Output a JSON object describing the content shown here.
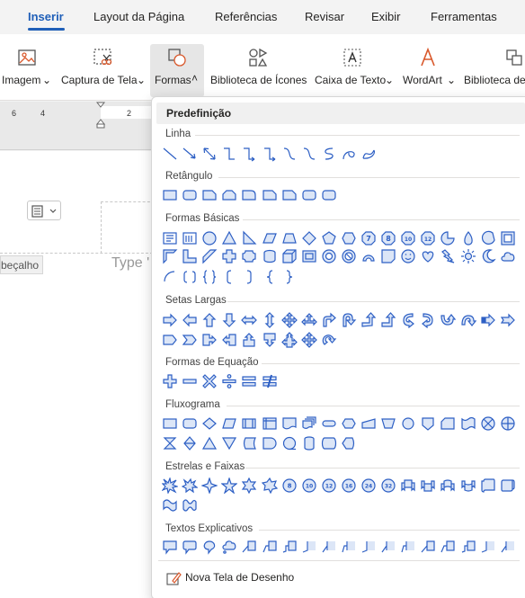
{
  "tabs": [
    {
      "label": "Inserir",
      "active": true
    },
    {
      "label": "Layout da Página"
    },
    {
      "label": "Referências"
    },
    {
      "label": "Revisar"
    },
    {
      "label": "Exibir"
    },
    {
      "label": "Ferramentas"
    }
  ],
  "ribbon": {
    "image": "Imagem",
    "screenshot": "Captura de Tela",
    "shapes": "Formas",
    "icons": "Biblioteca de Ícones",
    "textbox": "Caixa de Texto",
    "wordart": "WordArt",
    "library": "Biblioteca de"
  },
  "ruler": {
    "n6": "6",
    "n4": "4",
    "n2": "2"
  },
  "document": {
    "header_tag": "beçalho",
    "type_text": "Type '"
  },
  "panel": {
    "title": "Predefinição",
    "sections": {
      "line": "Linha",
      "rect": "Retângulo",
      "basic": "Formas Básicas",
      "arrows": "Setas Largas",
      "equation": "Formas de Equação",
      "flow": "Fluxograma",
      "stars": "Estrelas e Faixas",
      "callouts": "Textos Explicativos"
    },
    "new_canvas": "Nova Tela de Desenho",
    "badges": {
      "n7": "7",
      "n8": "8",
      "n10": "10",
      "n12": "12",
      "n16": "16",
      "n24": "24",
      "n32": "32"
    }
  },
  "colors": {
    "accent": "#1f5fb8",
    "shape_stroke": "#2d5fc4",
    "shape_fill": "#dce6f7"
  }
}
